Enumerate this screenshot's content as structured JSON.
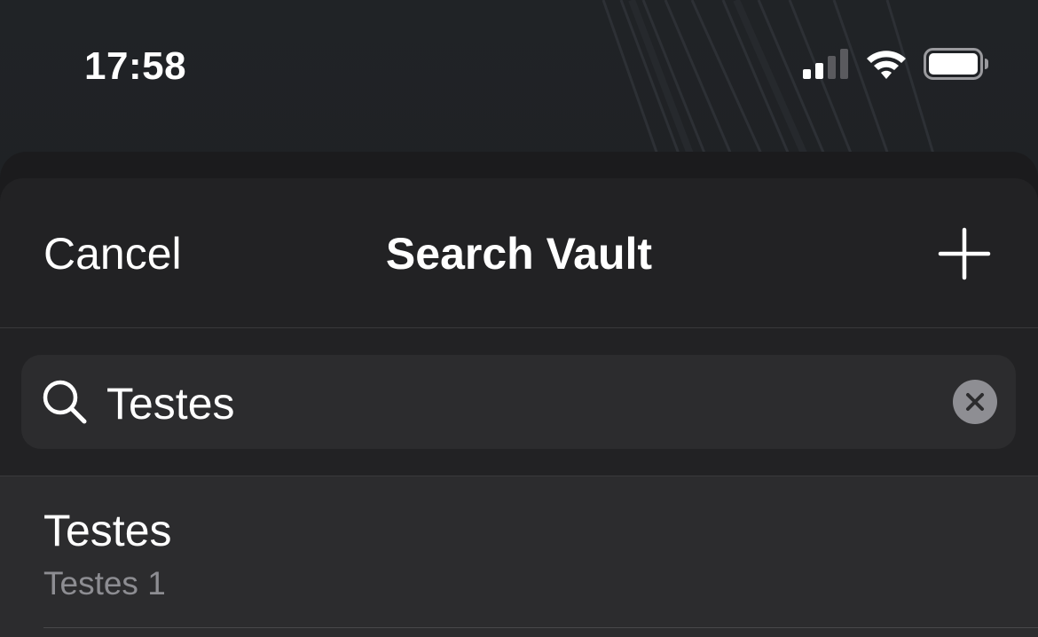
{
  "status_bar": {
    "time": "17:58",
    "icons": [
      "cellular-signal-icon",
      "wifi-icon",
      "battery-icon"
    ]
  },
  "nav": {
    "cancel_label": "Cancel",
    "title": "Search Vault",
    "add_icon": "plus-icon"
  },
  "search": {
    "value": "Testes",
    "icon": "search-icon",
    "clear_icon": "clear-icon"
  },
  "results": [
    {
      "title": "Testes",
      "subtitle": "Testes 1"
    }
  ],
  "colors": {
    "background": "#1d1f22",
    "sheet": "#222224",
    "field": "#2c2c2e",
    "secondary_text": "#8d8d92",
    "clear_button": "#8e8e93"
  }
}
